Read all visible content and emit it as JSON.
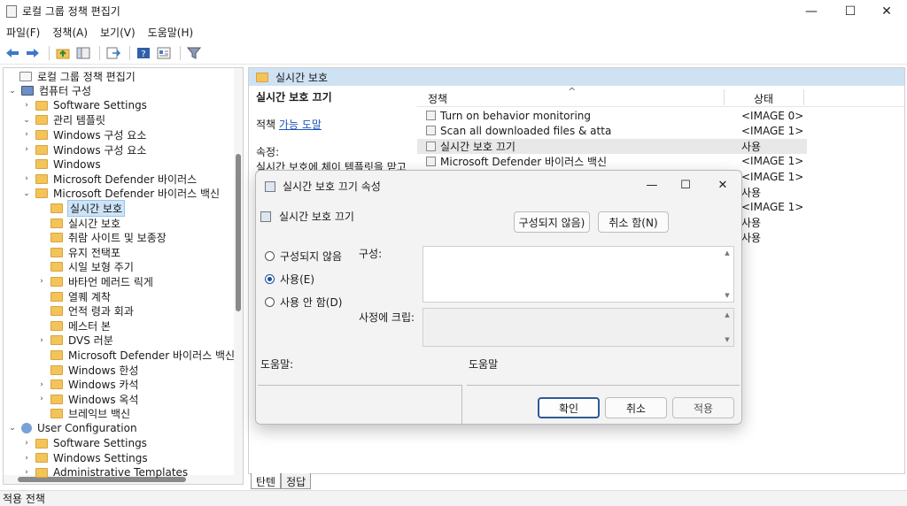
{
  "window": {
    "title": "로컬 그룹 정책 편집기",
    "minimize": "—",
    "maximize": "☐",
    "close": "✕"
  },
  "menu": [
    "파일(F)",
    "정책(A)",
    "보기(V)",
    "도움말(H)"
  ],
  "toolbar_icons": [
    "back-arrow-icon",
    "forward-arrow-icon",
    "up-folder-icon",
    "show-hide-tree-icon",
    "export-list-icon",
    "help-icon",
    "properties-icon",
    "filter-icon"
  ],
  "tree": [
    {
      "label": "로컬 그룹 정책 편집기",
      "level": 0,
      "arrow": "",
      "icon": "doc"
    },
    {
      "label": "컴퓨터 구성",
      "level": 1,
      "arrow": "⌄",
      "icon": "comp"
    },
    {
      "label": "Software Settings",
      "level": 2,
      "arrow": "›",
      "icon": "folder"
    },
    {
      "label": "관리 템플릿",
      "level": 2,
      "arrow": "⌄",
      "icon": "folder"
    },
    {
      "label": "Windows 구성 요소",
      "level": 3,
      "arrow": "›",
      "icon": "folder"
    },
    {
      "label": "Windows 구성 요소",
      "level": 3,
      "arrow": "›",
      "icon": "folder"
    },
    {
      "label": "Windows",
      "level": 3,
      "arrow": "",
      "icon": "folder"
    },
    {
      "label": "Microsoft Defender 바이러스",
      "level": 3,
      "arrow": "›",
      "icon": "folder"
    },
    {
      "label": "Microsoft Defender 바이러스 백신",
      "level": 3,
      "arrow": "⌄",
      "icon": "folder"
    },
    {
      "label": "실시간 보호",
      "level": 4,
      "arrow": "",
      "icon": "folder",
      "selected": true
    },
    {
      "label": "실시간 보호",
      "level": 4,
      "arrow": "",
      "icon": "folder"
    },
    {
      "label": "취람 사이트 및 보종장",
      "level": 4,
      "arrow": "",
      "icon": "folder"
    },
    {
      "label": "유지 전택포",
      "level": 4,
      "arrow": "",
      "icon": "folder"
    },
    {
      "label": "시일 보형 주기",
      "level": 4,
      "arrow": "",
      "icon": "folder"
    },
    {
      "label": "바타언 메러드 릭게",
      "level": 4,
      "arrow": "›",
      "icon": "folder"
    },
    {
      "label": "열퀘 계착",
      "level": 4,
      "arrow": "",
      "icon": "folder"
    },
    {
      "label": "언적 령과 회과",
      "level": 4,
      "arrow": "",
      "icon": "folder"
    },
    {
      "label": "메스터 본",
      "level": 4,
      "arrow": "",
      "icon": "folder"
    },
    {
      "label": "DVS 러분",
      "level": 4,
      "arrow": "›",
      "icon": "folder"
    },
    {
      "label": "Microsoft Defender 바이러스 백신",
      "level": 4,
      "arrow": "",
      "icon": "folder"
    },
    {
      "label": "Windows 한성",
      "level": 4,
      "arrow": "",
      "icon": "folder"
    },
    {
      "label": "Windows 카석",
      "level": 4,
      "arrow": "›",
      "icon": "folder"
    },
    {
      "label": "Windows 옥석",
      "level": 4,
      "arrow": "›",
      "icon": "folder"
    },
    {
      "label": "브레익브 백신",
      "level": 4,
      "arrow": "",
      "icon": "folder"
    },
    {
      "label": "User Configuration",
      "level": 1,
      "arrow": "⌄",
      "icon": "user"
    },
    {
      "label": "Software Settings",
      "level": 2,
      "arrow": "›",
      "icon": "folder"
    },
    {
      "label": "Windows Settings",
      "level": 2,
      "arrow": "›",
      "icon": "folder"
    },
    {
      "label": "Administrative Templates",
      "level": 2,
      "arrow": "›",
      "icon": "folder"
    }
  ],
  "right": {
    "header": "실시간 보호",
    "desc_title": "실시간 보호 끄기",
    "desc_edit_prefix": "적책",
    "desc_edit_link": "가능 도말",
    "desc_req": "속정:",
    "desc_text": "실시간 보호에 체이 템플릿을 맏고",
    "col_policy": "정책",
    "col_state": "상태",
    "sort_arrow": "^",
    "rows": [
      {
        "name": "Turn on behavior monitoring",
        "state": "<IMAGE 0>"
      },
      {
        "name": "Scan all downloaded files & atta",
        "state": "<IMAGE 1>"
      },
      {
        "name": "실시간 보호 끄기",
        "state": "사용",
        "selected": true
      },
      {
        "name": "Microsoft Defender 바이러스 백신",
        "state": "<IMAGE 1>"
      },
      {
        "name": "",
        "state": "<IMAGE 1>"
      },
      {
        "name": "",
        "state": "사용"
      },
      {
        "name": "",
        "state": "<IMAGE 1>"
      },
      {
        "name": "",
        "state": "사용"
      },
      {
        "name": "",
        "state": "사용"
      }
    ]
  },
  "tabs": [
    "탄텐",
    "정답"
  ],
  "status": "적용 전책",
  "dialog": {
    "title": "실시간 보호 끄기 속성",
    "subtitle": "실시간 보호 끄기",
    "prev_btn": "구성되지 않음)",
    "next_btn": "취소 함(N)",
    "radios": [
      {
        "label": "구성되지 않음",
        "checked": false
      },
      {
        "label": "사용(E)",
        "checked": true
      },
      {
        "label": "사용 안 함(D)",
        "checked": false
      }
    ],
    "comment_label": "구성:",
    "supported_label": "사정에 크립:",
    "options_label": "도움말:",
    "help_label": "도움말",
    "ok": "확인",
    "cancel": "취소",
    "apply": "적용"
  }
}
